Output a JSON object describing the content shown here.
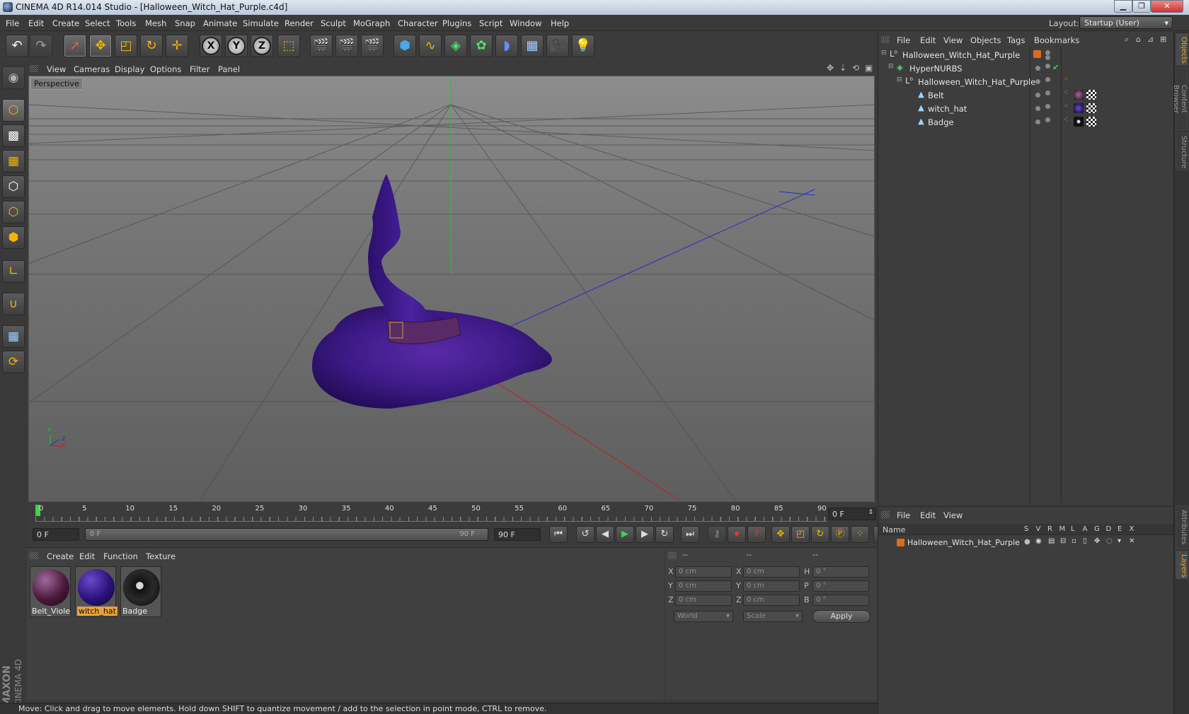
{
  "window": {
    "title": "CINEMA 4D R14.014 Studio - [Halloween_Witch_Hat_Purple.c4d]",
    "minimize": "▁",
    "maximize": "❐",
    "close": "✕"
  },
  "menubar": {
    "items": [
      "File",
      "Edit",
      "Create",
      "Select",
      "Tools",
      "Mesh",
      "Snap",
      "Animate",
      "Simulate",
      "Render",
      "Sculpt",
      "MoGraph",
      "Character",
      "Plugins",
      "Script",
      "Window",
      "Help"
    ],
    "layout_label": "Layout:",
    "layout_value": "Startup (User)"
  },
  "toolbar": {
    "x": "X",
    "y": "Y",
    "z": "Z"
  },
  "viewport": {
    "menu": [
      "View",
      "Cameras",
      "Display",
      "Options",
      "Filter",
      "Panel"
    ],
    "label": "Perspective",
    "axis_y": "Y",
    "axis_x": "X",
    "axis_z": "Z"
  },
  "timeline": {
    "ticks": [
      "0",
      "5",
      "10",
      "15",
      "20",
      "25",
      "30",
      "35",
      "40",
      "45",
      "50",
      "55",
      "60",
      "65",
      "70",
      "75",
      "80",
      "85",
      "90"
    ],
    "current_frame_field": "0 F",
    "start_field": "0 F",
    "range_start": "0 F",
    "range_end": "90 F",
    "end_field": "90 F"
  },
  "materials": {
    "menu": [
      "Create",
      "Edit",
      "Function",
      "Texture"
    ],
    "items": [
      {
        "name": "Belt_Violet"
      },
      {
        "name": "witch_hat"
      },
      {
        "name": "Badge"
      }
    ]
  },
  "coords": {
    "headers": [
      "--",
      "--",
      "--"
    ],
    "rows": [
      {
        "a": "X",
        "va": "0 cm",
        "b": "X",
        "vb": "0 cm",
        "c": "H",
        "vc": "0 °"
      },
      {
        "a": "Y",
        "va": "0 cm",
        "b": "Y",
        "vb": "0 cm",
        "c": "P",
        "vc": "0 °"
      },
      {
        "a": "Z",
        "va": "0 cm",
        "b": "Z",
        "vb": "0 cm",
        "c": "B",
        "vc": "0 °"
      }
    ],
    "mode": "World",
    "transform": "Scale",
    "apply": "Apply"
  },
  "status": {
    "text": "Move: Click and drag to move elements. Hold down SHIFT to quantize movement / add to the selection in point mode, CTRL to remove."
  },
  "objects": {
    "menu": [
      "File",
      "Edit",
      "View",
      "Objects",
      "Tags",
      "Bookmarks"
    ],
    "rows": [
      {
        "name": "Halloween_Witch_Hat_Purple"
      },
      {
        "name": "HyperNURBS"
      },
      {
        "name": "Halloween_Witch_Hat_Purple"
      },
      {
        "name": "Belt"
      },
      {
        "name": "witch_hat"
      },
      {
        "name": "Badge"
      }
    ]
  },
  "layers": {
    "menu": [
      "File",
      "Edit",
      "View"
    ],
    "name_header": "Name",
    "cols": [
      "S",
      "V",
      "R",
      "M",
      "L",
      "A",
      "G",
      "D",
      "E",
      "X"
    ],
    "row_name": "Halloween_Witch_Hat_Purple"
  },
  "side_tabs": [
    "Objects",
    "Content Browser",
    "Structure",
    "Attributes",
    "Layers"
  ],
  "logo": {
    "maxon": "MAXON",
    "c4d": "CINEMA 4D"
  },
  "colors": {
    "accent": "#e8a23a",
    "hat": "#3a1a7a"
  }
}
